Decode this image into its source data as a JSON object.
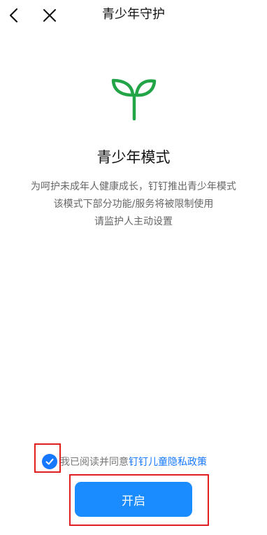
{
  "nav": {
    "title": "青少年守护",
    "back_icon": "chevron-left-icon",
    "close_icon": "close-icon"
  },
  "hero": {
    "icon": "sprout-icon",
    "icon_color": "#22a447",
    "title": "青少年模式",
    "description": [
      "为呵护未成年人健康成长，钉钉推出青少年模式",
      "该模式下部分功能/服务将被限制使用",
      "请监护人主动设置"
    ]
  },
  "agreement": {
    "checked": true,
    "text": "我已阅读并同意",
    "link": "钉钉儿童隐私政策",
    "check_icon": "checkmark-icon"
  },
  "actions": {
    "start_label": "开启"
  },
  "colors": {
    "accent": "#1677ff",
    "button": "#1a8cff",
    "highlight": "#e02020"
  }
}
